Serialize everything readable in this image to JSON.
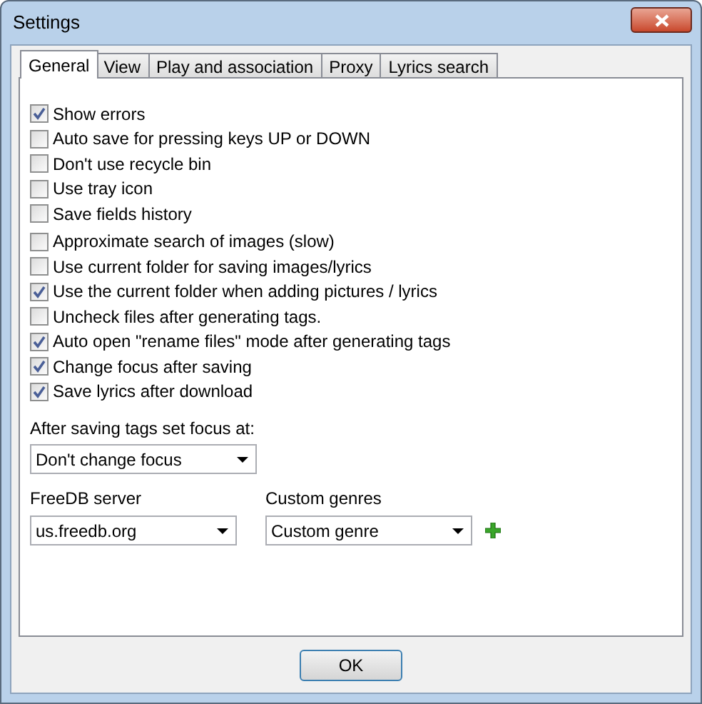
{
  "window": {
    "title": "Settings"
  },
  "tabs": [
    {
      "label": "General",
      "selected": true
    },
    {
      "label": "View",
      "selected": false
    },
    {
      "label": "Play and association",
      "selected": false
    },
    {
      "label": "Proxy",
      "selected": false
    },
    {
      "label": "Lyrics search",
      "selected": false
    }
  ],
  "option_groups": [
    [
      {
        "label": "Show errors",
        "checked": true
      },
      {
        "label": "Auto save for pressing keys UP or DOWN",
        "checked": false
      },
      {
        "label": "Don't use recycle bin",
        "checked": false
      },
      {
        "label": "Use tray icon",
        "checked": false
      },
      {
        "label": "Save fields history",
        "checked": false
      }
    ],
    [
      {
        "label": "Approximate search of images (slow)",
        "checked": false
      },
      {
        "label": "Use current folder for saving images/lyrics",
        "checked": false
      },
      {
        "label": "Use the current folder when adding pictures / lyrics",
        "checked": true
      },
      {
        "label": "Uncheck files after generating tags.",
        "checked": false
      },
      {
        "label": "Auto open \"rename files\" mode after generating tags",
        "checked": true
      },
      {
        "label": "Change focus after saving",
        "checked": true
      },
      {
        "label": "Save lyrics after download",
        "checked": true
      }
    ]
  ],
  "focus": {
    "label": "After saving tags set focus at:",
    "value": "Don't change focus"
  },
  "freedb": {
    "label": "FreeDB server",
    "value": "us.freedb.org"
  },
  "genres": {
    "label": "Custom genres",
    "value": "Custom genre"
  },
  "buttons": [
    "OK"
  ]
}
